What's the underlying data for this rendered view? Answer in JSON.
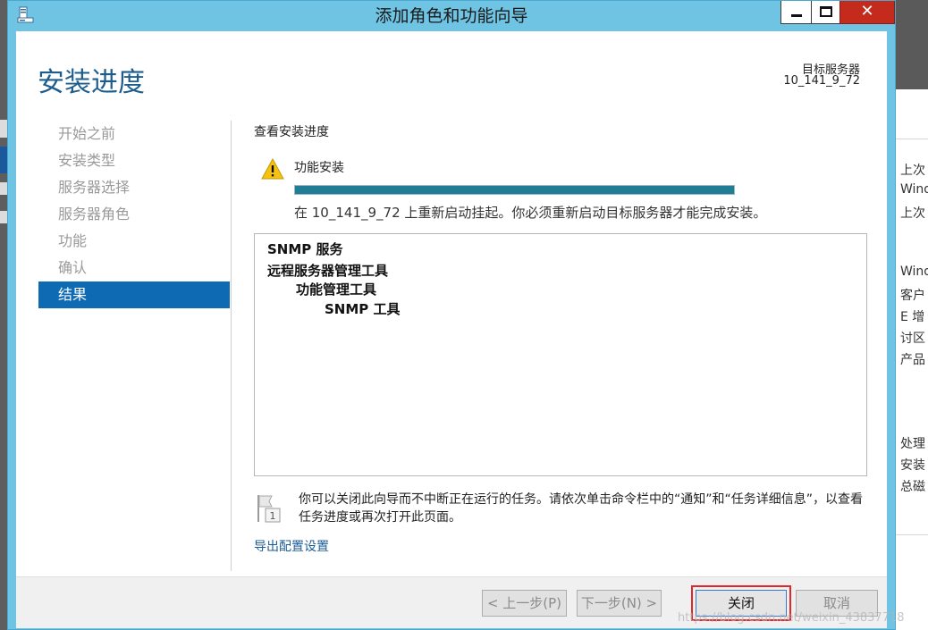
{
  "window": {
    "title": "添加角色和功能向导",
    "close_glyph": "✕"
  },
  "header": {
    "page_title": "安装进度",
    "target_label": "目标服务器",
    "target_value": "10_141_9_72"
  },
  "nav": {
    "items": [
      {
        "label": "开始之前",
        "active": false
      },
      {
        "label": "安装类型",
        "active": false
      },
      {
        "label": "服务器选择",
        "active": false
      },
      {
        "label": "服务器角色",
        "active": false
      },
      {
        "label": "功能",
        "active": false
      },
      {
        "label": "确认",
        "active": false
      },
      {
        "label": "结果",
        "active": true
      }
    ]
  },
  "content": {
    "section_heading": "查看安装进度",
    "feature_label": "功能安装",
    "progress_percent": 100,
    "status_message": "在 10_141_9_72 上重新启动挂起。你必须重新启动目标服务器才能完成安装。",
    "results": [
      {
        "text": "SNMP 服务",
        "level": 0
      },
      {
        "text": "远程服务器管理工具",
        "level": 0
      },
      {
        "text": "功能管理工具",
        "level": 1
      },
      {
        "text": "SNMP 工具",
        "level": 2
      }
    ],
    "info_text": "你可以关闭此向导而不中断正在运行的任务。请依次单击命令栏中的“通知”和“任务详细信息”，以查看任务进度或再次打开此页面。",
    "info_badge": "1",
    "export_link": "导出配置设置"
  },
  "footer": {
    "prev_label": "< 上一步(P)",
    "next_label": "下一步(N) >",
    "close_label": "关闭",
    "cancel_label": "取消",
    "watermark": "https://blog.csdn.net/weixin_43837718"
  },
  "background_right": {
    "lines": [
      "上次",
      "Wind",
      "上次",
      "Wind",
      "客户",
      "E 增",
      "讨区",
      "产品",
      "处理",
      "安装",
      "总磁"
    ]
  },
  "colors": {
    "title_bar": "#6fc3e3",
    "accent": "#0f6ab4",
    "progress": "#1f7d96",
    "highlight": "#e0282c"
  }
}
